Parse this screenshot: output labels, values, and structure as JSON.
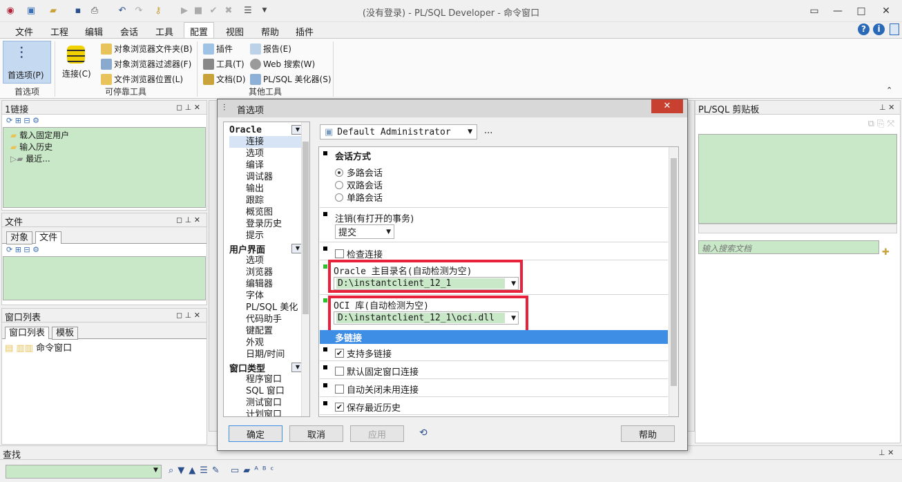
{
  "window": {
    "title": "(没有登录) - PL/SQL Developer - 命令窗口"
  },
  "menu": [
    "文件",
    "工程",
    "编辑",
    "会话",
    "工具",
    "配置",
    "视图",
    "帮助",
    "插件"
  ],
  "menu_active": "配置",
  "ribbon": {
    "prefs_label": "首选项(P)",
    "prefs_group": "首选项",
    "connect_label": "连接(C)",
    "dock_items": [
      "对象浏览器文件夹(B)",
      "对象浏览器过滤器(F)",
      "文件浏览器位置(L)"
    ],
    "dock_group": "可停靠工具",
    "other_col1": [
      "插件",
      "工具(T)",
      "文档(D)"
    ],
    "other_col2": [
      "报告(E)",
      "Web 搜索(W)",
      "PL/SQL 美化器(S)"
    ],
    "other_group": "其他工具"
  },
  "left": {
    "conn_title": "1链接",
    "conn_tree": [
      "载入固定用户",
      "输入历史",
      "最近..."
    ],
    "file_title": "文件",
    "file_tabs": [
      "对象",
      "文件"
    ],
    "winlist_title": "窗口列表",
    "winlist_tabs": [
      "窗口列表",
      "模板"
    ],
    "winlist_item": "命令窗口"
  },
  "right": {
    "title": "PL/SQL 剪贴板",
    "search_placeholder": "输入搜索文档"
  },
  "bottom": {
    "title": "查找"
  },
  "dialog": {
    "title": "首选项",
    "profile": "Default Administrator",
    "profile_more": "...",
    "nav_groups": [
      {
        "name": "Oracle",
        "items": [
          "连接",
          "选项",
          "编译",
          "调试器",
          "输出",
          "跟踪",
          "概览图",
          "登录历史",
          "提示"
        ]
      },
      {
        "name": "用户界面",
        "items": [
          "选项",
          "浏览器",
          "编辑器",
          "字体",
          "PL/SQL 美化",
          "代码助手",
          "键配置",
          "外观",
          "日期/时间"
        ]
      },
      {
        "name": "窗口类型",
        "items": [
          "程序窗口",
          "SQL 窗口",
          "测试窗口",
          "计划窗口"
        ]
      }
    ],
    "session_mode_title": "会话方式",
    "session_modes": [
      "多路会话",
      "双路会话",
      "单路会话"
    ],
    "session_mode_selected": 0,
    "logoff_title": "注销(有打开的事务)",
    "logoff_value": "提交",
    "check_conn": "检查连接",
    "oracle_home_label": "Oracle 主目录名(自动检测为空)",
    "oracle_home_value": "D:\\instantclient_12_1",
    "oci_label": "OCI 库(自动检测为空)",
    "oci_value": "D:\\instantclient_12_1\\oci.dll",
    "multi_section": "多链接",
    "options": [
      {
        "label": "支持多链接",
        "checked": true
      },
      {
        "label": "默认固定窗口连接",
        "checked": false
      },
      {
        "label": "自动关闭未用连接",
        "checked": false
      },
      {
        "label": "保存最近历史",
        "checked": true
      }
    ],
    "buttons": {
      "ok": "确定",
      "cancel": "取消",
      "apply": "应用",
      "help": "帮助"
    }
  }
}
